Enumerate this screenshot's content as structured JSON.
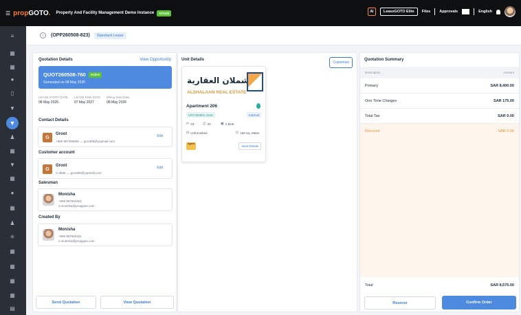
{
  "topbar": {
    "logo_part1": "prop",
    "logo_part2": "GOTO",
    "logo_dot": ".",
    "app_title": "Property And Facility Management Demo Instance",
    "env_badge": "STAGE",
    "ai_label": "AI",
    "lease_btn": "LeaseGOTO Elite",
    "files": "Files",
    "approvals": "Approvals",
    "language": "English"
  },
  "sidebar": {
    "active_icon": "people-icon"
  },
  "subheader": {
    "title": "(OPP260508-823)",
    "tag": "Standard Lease"
  },
  "quotation": {
    "heading": "Quotation Details",
    "view_opportunity": "View Opportunity",
    "number": "QUOT260508-760",
    "status": "Active",
    "generated": "Generated on 08 May 2026",
    "dates": [
      {
        "label": "LEASE START DATE",
        "value": "08 May 2026"
      },
      {
        "label": "LEASE END DATE",
        "value": "07 May 2027"
      },
      {
        "label": "Billing Start Date",
        "value": "08 May 2026"
      }
    ]
  },
  "contact": {
    "heading": "Contact Details",
    "initial": "G",
    "name": "Groot",
    "info": "+966 987456656 ↔ groot06@yopmail.com",
    "edit": "Edit"
  },
  "customer": {
    "heading": "Customer account",
    "initial": "G",
    "name": "Groot",
    "info": "A-3835 ↔ groot06@yopmail.com",
    "edit": "Edit"
  },
  "salesman": {
    "heading": "Salesman",
    "name": "Monisha",
    "phone": "+966 987654321",
    "email": "s.monisha@propgoto.com"
  },
  "created_by": {
    "heading": "Created By",
    "name": "Monisha",
    "phone": "+966 987654321",
    "email": "s.monisha@propgoto.com"
  },
  "actions": {
    "send": "Send Quotation",
    "view": "View Quotation"
  },
  "unit": {
    "heading": "Unit Details",
    "customize": "Customize",
    "logo_ar": "الشملان العقارية",
    "logo_en": "ALSHALAAN REAL ESTATE",
    "name": "Apartment 206",
    "id": "UNT250601-1516",
    "type": "Internal",
    "beds": "03",
    "baths": "02",
    "bhk": "2 BHK",
    "furnish": "Unfurnished",
    "area": "160 Sq. Meter",
    "agency_logo_text": "Agent",
    "view_details": "View Details"
  },
  "summary": {
    "heading": "Quotation Summary",
    "col_desc": "Description",
    "col_amount": "Amount",
    "rows": [
      {
        "label": "Primary",
        "amount": "SAR 8,400.00"
      },
      {
        "label": "One Time Charges",
        "amount": "SAR 175.00"
      },
      {
        "label": "Total Tax",
        "amount": "SAR 0.00"
      }
    ],
    "discount_label": "Discount",
    "discount_amount": "- SAR 0.00",
    "total_label": "Total",
    "total_amount": "SAR 8,575.00",
    "reserve": "Reserve",
    "confirm": "Confirm Order"
  }
}
